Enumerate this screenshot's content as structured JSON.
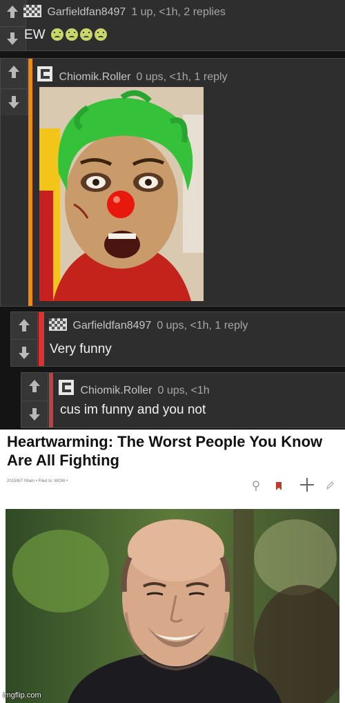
{
  "thread": {
    "comments": [
      {
        "user": "Garfieldfan8497",
        "stats": "1 up, <1h, 2 replies",
        "text": "EW",
        "emoji_count": 4,
        "stripe_color": "",
        "avatar": "checker-avatar-icon"
      },
      {
        "user": "Chiomik.Roller",
        "stats": "0 ups, <1h, 1 reply",
        "text": "",
        "stripe_color": "#f08a0c",
        "avatar": "bracket-avatar-icon",
        "image": "clown-photo"
      },
      {
        "user": "Garfieldfan8497",
        "stats": "0 ups, <1h, 1 reply",
        "text": "Very funny",
        "stripe_color": "#e03131",
        "avatar": "checker-avatar-icon"
      },
      {
        "user": "Chiomik.Roller",
        "stats": "0 ups, <1h",
        "text": "cus im funny and you not",
        "stripe_color": "#b04646",
        "avatar": "bracket-avatar-icon"
      }
    ]
  },
  "meme": {
    "headline": "Heartwarming: The Worst People You Know Are All Fighting",
    "byline": "2015/8/7 08am • Filed to: WOW •"
  },
  "watermark": "imgflip.com",
  "colors": {
    "background": "#141414",
    "comment_bg": "#2e2e2e",
    "orange_stripe": "#f08a0c",
    "red_stripe": "#e03131"
  }
}
